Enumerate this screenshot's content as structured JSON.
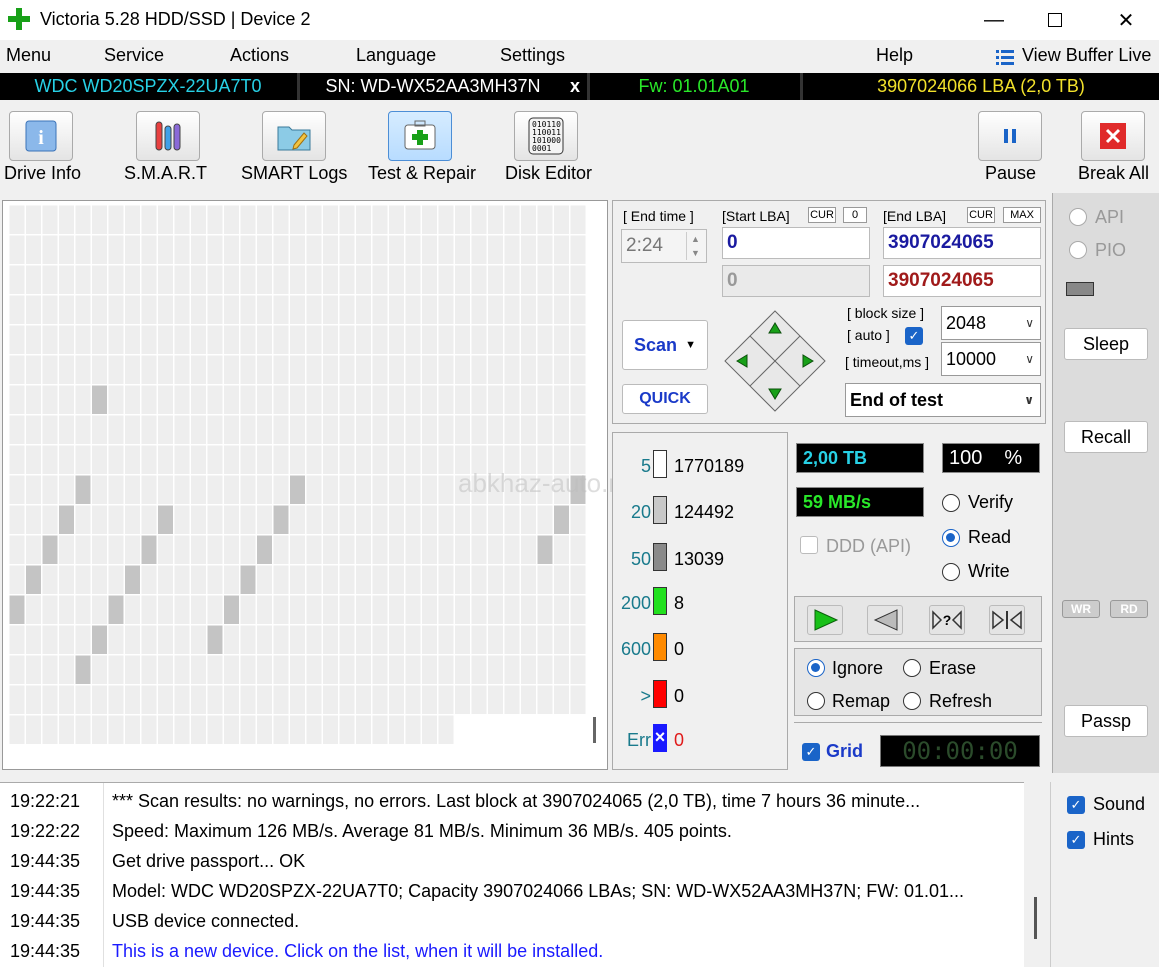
{
  "window": {
    "title": "Victoria 5.28 HDD/SSD | Device 2"
  },
  "menu": {
    "items": [
      "Menu",
      "Service",
      "Actions",
      "Language",
      "Settings",
      "Help"
    ],
    "view_buffer": "View Buffer Live"
  },
  "drive": {
    "model": "WDC WD20SPZX-22UA7T0",
    "serial": "SN: WD-WX52AA3MH37N",
    "close": "x",
    "firmware": "Fw: 01.01A01",
    "capacity": "3907024066 LBA (2,0 TB)"
  },
  "toolbar": {
    "buttons": [
      "Drive Info",
      "S.M.A.R.T",
      "SMART Logs",
      "Test & Repair",
      "Disk Editor"
    ],
    "pause": "Pause",
    "break_all": "Break All",
    "active": "Test & Repair"
  },
  "controls": {
    "end_time_label": "[ End time ]",
    "end_time": "2:24",
    "start_lba_label": "[Start LBA]",
    "cur": "CUR",
    "start_zero": "0",
    "end_lba_label": "[End LBA]",
    "max": "MAX",
    "start_lba": "0",
    "end_lba": "3907024065",
    "start_lba_2": "0",
    "end_lba_2": "3907024065",
    "block_size_label": "[ block size ]",
    "auto_label": "[ auto ]",
    "block_size": "2048",
    "timeout_label": "[ timeout,ms ]",
    "timeout": "10000",
    "scan": "Scan",
    "quick": "QUICK",
    "end_action": "End of test"
  },
  "stats": [
    {
      "label": "5",
      "value": "1770189",
      "color": "#ffffff"
    },
    {
      "label": "20",
      "value": "124492",
      "color": "#c8c8c8"
    },
    {
      "label": "50",
      "value": "13039",
      "color": "#8a8a8a"
    },
    {
      "label": "200",
      "value": "8",
      "color": "#22e01e"
    },
    {
      "label": "600",
      "value": "0",
      "color": "#ff8a00"
    },
    {
      "label": ">",
      "value": "0",
      "color": "#ff0000"
    },
    {
      "label": "Err",
      "value": "0",
      "color": "#1a1aff"
    }
  ],
  "progress": {
    "size": "2,00 TB",
    "percent": "100",
    "percent_sign": "%",
    "speed": "59 MB/s"
  },
  "modes": {
    "ddd": "DDD (API)",
    "verify": "Verify",
    "read": "Read",
    "write": "Write",
    "selected": "Read"
  },
  "repair": {
    "ignore": "Ignore",
    "erase": "Erase",
    "remap": "Remap",
    "refresh": "Refresh",
    "selected": "Ignore"
  },
  "grid_label": "Grid",
  "timer": "00:00:00",
  "side": {
    "api": "API",
    "pio": "PIO",
    "sleep": "Sleep",
    "recall": "Recall",
    "wr": "WR",
    "rd": "RD",
    "passp": "Passp"
  },
  "options": {
    "sound": "Sound",
    "hints": "Hints"
  },
  "watermark": "abkhaz-auto.ru",
  "log": [
    {
      "time": "19:22:21",
      "text": "*** Scan results: no warnings, no errors. Last block at 3907024065 (2,0 TB), time 7 hours 36 minute...",
      "color": "#000000"
    },
    {
      "time": "19:22:22",
      "text": "Speed: Maximum 126 MB/s. Average 81 MB/s. Minimum 36 MB/s. 405 points.",
      "color": "#000000"
    },
    {
      "time": "19:44:35",
      "text": "Get drive passport... OK",
      "color": "#000000"
    },
    {
      "time": "19:44:35",
      "text": "Model: WDC WD20SPZX-22UA7T0; Capacity 3907024066 LBAs; SN: WD-WX52AA3MH37N; FW: 01.01...",
      "color": "#000000"
    },
    {
      "time": "19:44:35",
      "text": "USB device connected.",
      "color": "#000000"
    },
    {
      "time": "19:44:35",
      "text": "This is a new device. Click on the list, when it will be installed.",
      "color": "#1a1aff"
    }
  ]
}
